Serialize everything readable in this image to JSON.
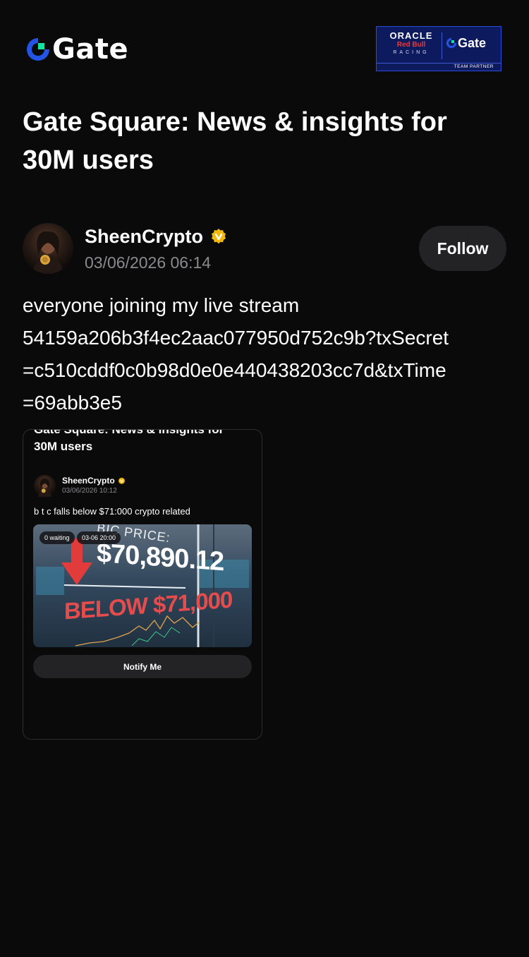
{
  "brand": {
    "name": "Gate",
    "accent_color": "#2354e6",
    "green_color": "#17e3a0"
  },
  "partner_badge": {
    "oracle": "ORACLE",
    "redbull": "Red Bull",
    "racing": "RACING",
    "gate": "Gate",
    "footer": "TEAM PARTNER"
  },
  "page": {
    "title": "Gate Square: News & insights for 30M users"
  },
  "post": {
    "author": {
      "name": "SheenCrypto",
      "verified_icon": "verified-badge-icon",
      "time": "03/06/2026 06:14"
    },
    "follow_label": "Follow",
    "body_lines": [
      "everyone joining my live stream",
      "54159a206b3f4ec2aac077950d752c9b?txSecret",
      "=c510cddf0c0b98d0e0e440438203cc7d&txTime",
      "=69abb3e5"
    ]
  },
  "preview_card": {
    "title_line_1": "Gate Square: News & insights for",
    "title_line_2": "30M users",
    "author": {
      "name": "SheenCrypto",
      "time": "03/06/2026 10:12"
    },
    "text": "b t c  falls below $71:000 crypto related",
    "image": {
      "waiting_label": "0 waiting",
      "date_label": "03-06 20:00",
      "heading": "BIC PRICE:",
      "price": "$70,890.12",
      "below_text": "BELOW $71,000"
    },
    "notify_label": "Notify Me"
  }
}
